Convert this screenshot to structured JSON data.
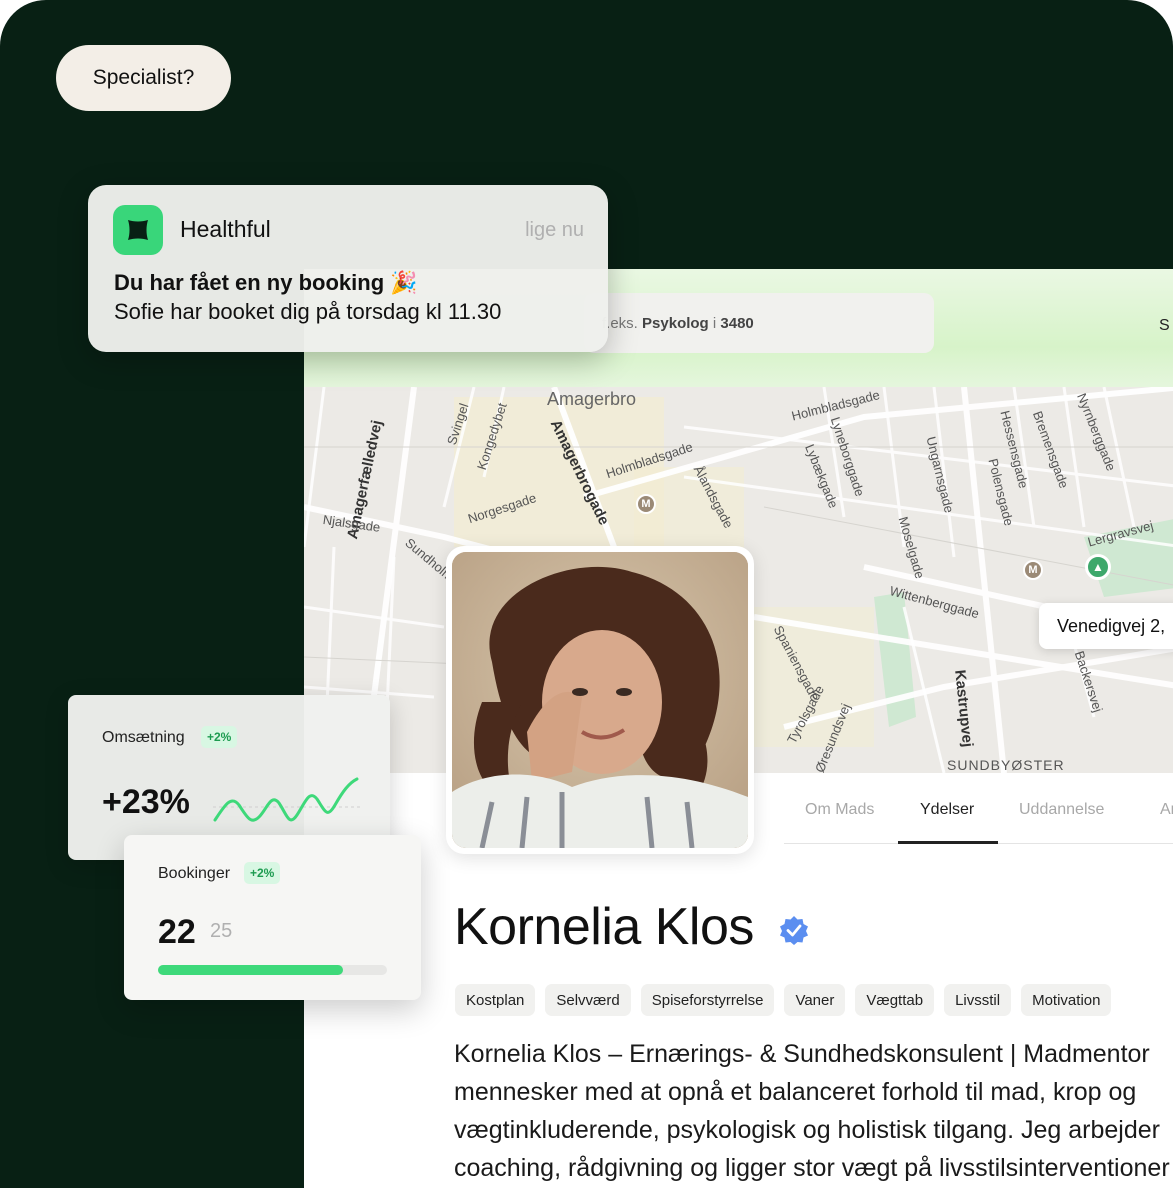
{
  "specialist_pill": "Specialist?",
  "search": {
    "prefix": "f.eks.",
    "query": "Psykolog",
    "connector": "i",
    "zip": "3480"
  },
  "header_right_text": "S",
  "notification": {
    "app_name": "Healthful",
    "time": "lige nu",
    "title": "Du har fået en ny booking 🎉",
    "body": "Sofie har booket dig på torsdag kl 11.30"
  },
  "map": {
    "district_labels": [
      "Amagerbro",
      "SUNDBYØSTER"
    ],
    "street_labels": [
      "Amagerfælledvej",
      "Svingel",
      "Kongedybet",
      "Amagerbrogade",
      "Holmbladsgade",
      "Ålandsgade",
      "Norgesgade",
      "Njalsgade",
      "Sundholmsvej",
      "Lybækgade",
      "Lyneborggade",
      "Ungarnsgade",
      "Hessensgade",
      "Polensgade",
      "Bremensgade",
      "Nyrnberggade",
      "Moselgade",
      "Wittenberggade",
      "Lergravsvej",
      "Spaniensgade",
      "Tyrolsgade",
      "Øresundsvej",
      "Kastrupvej",
      "Backersvej",
      "Holmbladsgade"
    ],
    "metro_symbol": "M",
    "address_pill": "Venedigvej 2,"
  },
  "tabs": [
    "Om Mads",
    "Ydelser",
    "Uddannelse",
    "An"
  ],
  "active_tab": "Ydelser",
  "profile": {
    "name": "Kornelia Klos",
    "verified": true,
    "tags": [
      "Kostplan",
      "Selvværd",
      "Spiseforstyrrelse",
      "Vaner",
      "Vægttab",
      "Livsstil",
      "Motivation"
    ],
    "bio_lines": [
      "Kornelia Klos – Ernærings- & Sundhedskonsulent | Madmentor",
      "mennesker med at opnå et balanceret forhold til mad, krop og",
      "vægtinkluderende, psykologisk og holistisk tilgang. Jeg arbejder",
      "coaching, rådgivning og ligger stor vægt på livsstilsinterventioner"
    ]
  },
  "revenue_card": {
    "label": "Omsætning",
    "badge": "+2%",
    "value": "+23%"
  },
  "bookings_card": {
    "label": "Bookinger",
    "badge": "+2%",
    "value": "22",
    "total": "25",
    "progress": 0.81
  },
  "colors": {
    "dark_bg": "#082014",
    "accent_green": "#3ed97a",
    "badge_bg": "#d8f7e3",
    "verified_blue": "#5b8ef0"
  }
}
